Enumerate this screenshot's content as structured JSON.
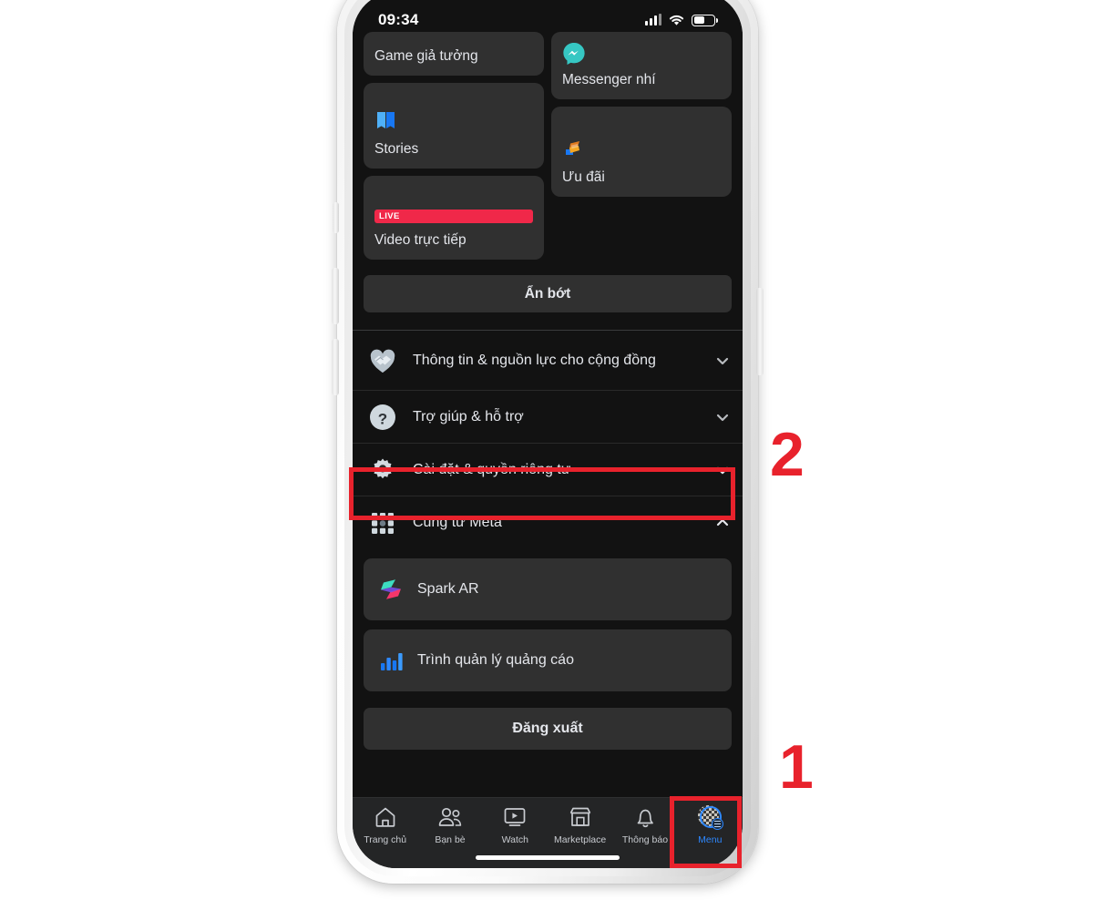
{
  "statusbar": {
    "time": "09:34",
    "signal_icon": "cellular-signal-icon",
    "wifi_icon": "wifi-icon",
    "battery_icon": "battery-icon"
  },
  "tiles": {
    "left": [
      {
        "label": "Game giả tưởng",
        "icon": "game-icon"
      },
      {
        "label": "Stories",
        "icon": "stories-book-icon"
      },
      {
        "label": "Video trực tiếp",
        "icon": "live-badge",
        "badge": "LIVE"
      }
    ],
    "right": [
      {
        "label": "Messenger nhí",
        "icon": "messenger-kids-icon"
      },
      {
        "label": "Ưu đãi",
        "icon": "offers-icon"
      }
    ]
  },
  "hide_button": {
    "label": "Ẩn bớt"
  },
  "list_rows": [
    {
      "label": "Thông tin & nguồn lực cho cộng đồng",
      "icon": "handshake-heart-icon",
      "chevron": "chevron-down-icon",
      "highlighted": false
    },
    {
      "label": "Trợ giúp & hỗ trợ",
      "icon": "question-mark-icon",
      "chevron": "chevron-down-icon",
      "highlighted": false
    },
    {
      "label": "Cài đặt & quyền riêng tư",
      "icon": "gear-icon",
      "chevron": "chevron-down-icon",
      "highlighted": true
    },
    {
      "label": "Cũng từ Meta",
      "icon": "grid-apps-icon",
      "chevron": "chevron-up-icon",
      "highlighted": false
    }
  ],
  "meta_apps": [
    {
      "label": "Spark AR",
      "icon": "spark-ar-icon"
    },
    {
      "label": "Trình quản lý quảng cáo",
      "icon": "ads-manager-bars-icon"
    }
  ],
  "logout": {
    "label": "Đăng xuất"
  },
  "tabs": [
    {
      "label": "Trang chủ",
      "icon": "home-icon",
      "active": false
    },
    {
      "label": "Bạn bè",
      "icon": "friends-icon",
      "active": false
    },
    {
      "label": "Watch",
      "icon": "watch-play-icon",
      "active": false
    },
    {
      "label": "Marketplace",
      "icon": "marketplace-store-icon",
      "active": false
    },
    {
      "label": "Thông báo",
      "icon": "bell-icon",
      "active": false
    },
    {
      "label": "Menu",
      "icon": "profile-avatar-menu-icon",
      "active": true
    }
  ],
  "annotations": [
    {
      "label": "2",
      "target": "settings-row"
    },
    {
      "label": "1",
      "target": "menu-tab"
    }
  ],
  "colors": {
    "accent_blue": "#2d88ff",
    "annotation_red": "#e8222c",
    "screen_bg": "#121212",
    "tile_bg": "#303030",
    "tabbar_bg": "#242526"
  }
}
